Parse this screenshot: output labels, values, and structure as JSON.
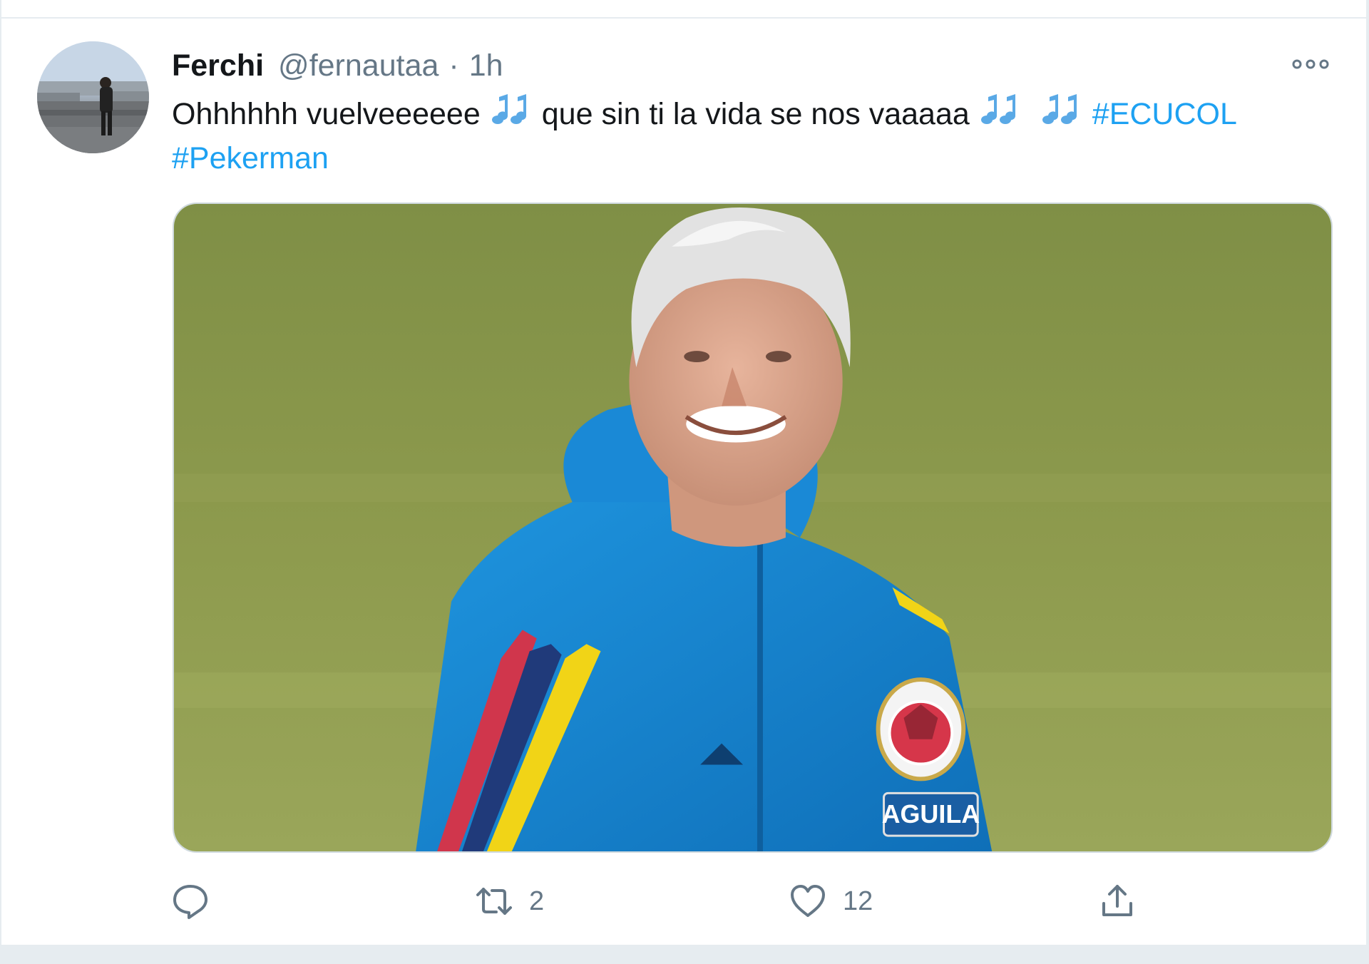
{
  "tweet": {
    "author": {
      "name": "Ferchi",
      "handle": "@fernautaa",
      "separator": "·",
      "time": "1h"
    },
    "text": {
      "line1": {
        "part1": "Ohhhhhh vuelveeeeee",
        "part2": "que sin ti la vida se nos vaaaaa",
        "hashtag1": "#ECUCOL"
      },
      "line2": {
        "hashtag2": "#Pekerman"
      },
      "emoji": "music-notes"
    },
    "media": {
      "jacket_patch_text": "AGUILA"
    },
    "actions": {
      "reply_count": "",
      "retweet_count": "2",
      "like_count": "12"
    }
  },
  "icons": {
    "reply": "speech-bubble-icon",
    "retweet": "retweet-arrows-icon",
    "like": "heart-icon",
    "share": "share-upload-icon",
    "more": "more-dots-icon"
  },
  "colors": {
    "accent": "#1da1f2",
    "text": "#14171a",
    "secondary": "#657786",
    "border": "#e6ecf0"
  }
}
